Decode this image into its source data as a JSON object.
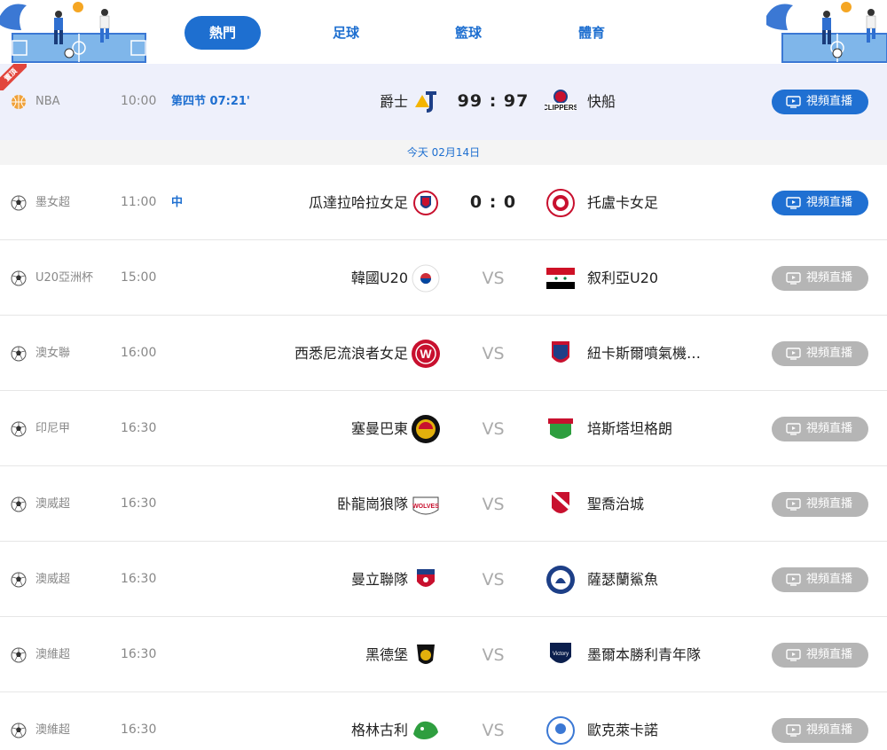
{
  "tabs": [
    {
      "label": "熱門",
      "active": true
    },
    {
      "label": "足球",
      "active": false
    },
    {
      "label": "籃球",
      "active": false
    },
    {
      "label": "體育",
      "active": false
    }
  ],
  "top_match": {
    "badge": "置頂",
    "sport": "basketball",
    "league": "NBA",
    "time": "10:00",
    "status": "第四节 07:21'",
    "home": "爵士",
    "home_logo": "jazz-logo",
    "score": "99 : 97",
    "away": "快船",
    "away_logo": "clippers-logo",
    "button": "視頻直播"
  },
  "date_label": "今天 02月14日",
  "matches": [
    {
      "league": "墨女超",
      "time": "11:00",
      "status": "中",
      "home": "瓜達拉哈拉女足",
      "score": "0 : 0",
      "away": "托盧卡女足",
      "button": "視頻直播",
      "live": true
    },
    {
      "league": "U20亞洲杯",
      "time": "15:00",
      "status": "",
      "home": "韓國U20",
      "vs": "VS",
      "away": "叙利亞U20",
      "button": "視頻直播",
      "live": false
    },
    {
      "league": "澳女聯",
      "time": "16:00",
      "status": "",
      "home": "西悉尼流浪者女足",
      "vs": "VS",
      "away": "紐卡斯爾噴氣機…",
      "button": "視頻直播",
      "live": false
    },
    {
      "league": "印尼甲",
      "time": "16:30",
      "status": "",
      "home": "塞曼巴東",
      "vs": "VS",
      "away": "培斯塔坦格朗",
      "button": "視頻直播",
      "live": false
    },
    {
      "league": "澳威超",
      "time": "16:30",
      "status": "",
      "home": "卧龍崗狼隊",
      "vs": "VS",
      "away": "聖喬治城",
      "button": "視頻直播",
      "live": false
    },
    {
      "league": "澳威超",
      "time": "16:30",
      "status": "",
      "home": "曼立聯隊",
      "vs": "VS",
      "away": "薩瑟蘭鯊魚",
      "button": "視頻直播",
      "live": false
    },
    {
      "league": "澳維超",
      "time": "16:30",
      "status": "",
      "home": "黑德堡",
      "vs": "VS",
      "away": "墨爾本勝利青年隊",
      "button": "視頻直播",
      "live": false
    },
    {
      "league": "澳維超",
      "time": "16:30",
      "status": "",
      "home": "格林古利",
      "vs": "VS",
      "away": "歐克萊卡諾",
      "button": "視頻直播",
      "live": false
    }
  ],
  "colors": {
    "accent": "#1e6fd0",
    "live_button": "#2070d2",
    "disabled_button": "#b5b5b5",
    "badge": "#e2453c"
  }
}
